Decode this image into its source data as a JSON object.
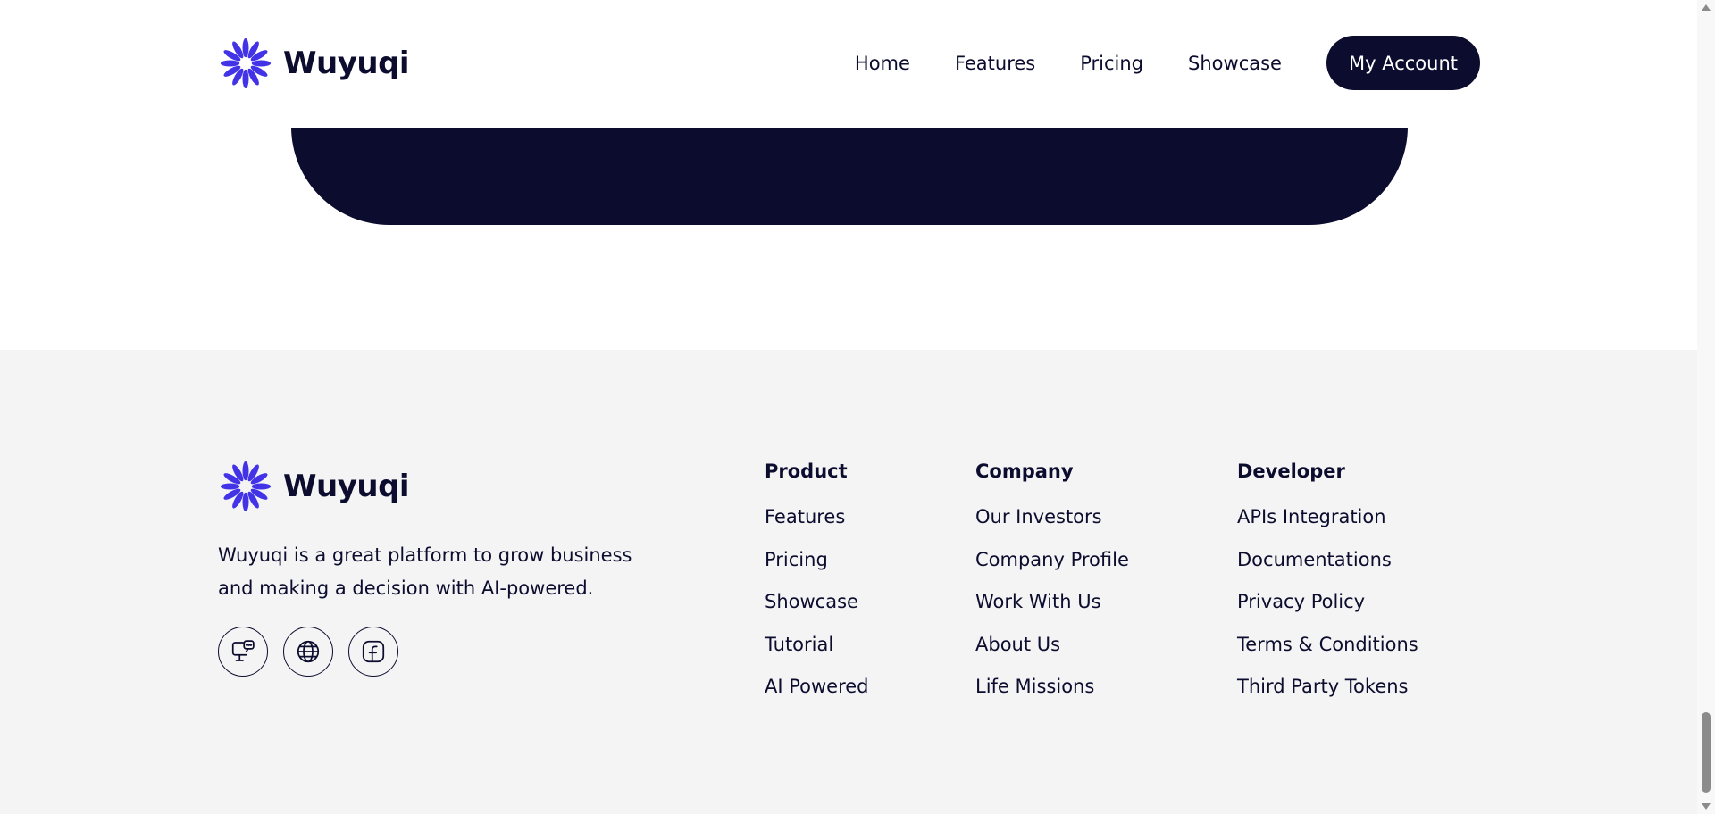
{
  "brand": {
    "name": "Wuyuqi",
    "color": "#4333e6"
  },
  "nav": {
    "items": [
      "Home",
      "Features",
      "Pricing",
      "Showcase"
    ],
    "account_label": "My Account"
  },
  "footer": {
    "brand_name": "Wuyuqi",
    "description": "Wuyuqi is a great platform to grow business and making a decision with AI-powered.",
    "socials": [
      "monitor-chat-icon",
      "globe-icon",
      "facebook-icon"
    ],
    "columns": [
      {
        "title": "Product",
        "links": [
          "Features",
          "Pricing",
          "Showcase",
          "Tutorial",
          "AI Powered"
        ]
      },
      {
        "title": "Company",
        "links": [
          "Our Investors",
          "Company Profile",
          "Work With Us",
          "About Us",
          "Life Missions"
        ]
      },
      {
        "title": "Developer",
        "links": [
          "APIs Integration",
          "Documentations",
          "Privacy Policy",
          "Terms & Conditions",
          "Third Party Tokens"
        ]
      }
    ]
  },
  "colors": {
    "dark": "#0c0d2e",
    "footer_bg": "#f4f4f5",
    "accent": "#4333e6"
  }
}
